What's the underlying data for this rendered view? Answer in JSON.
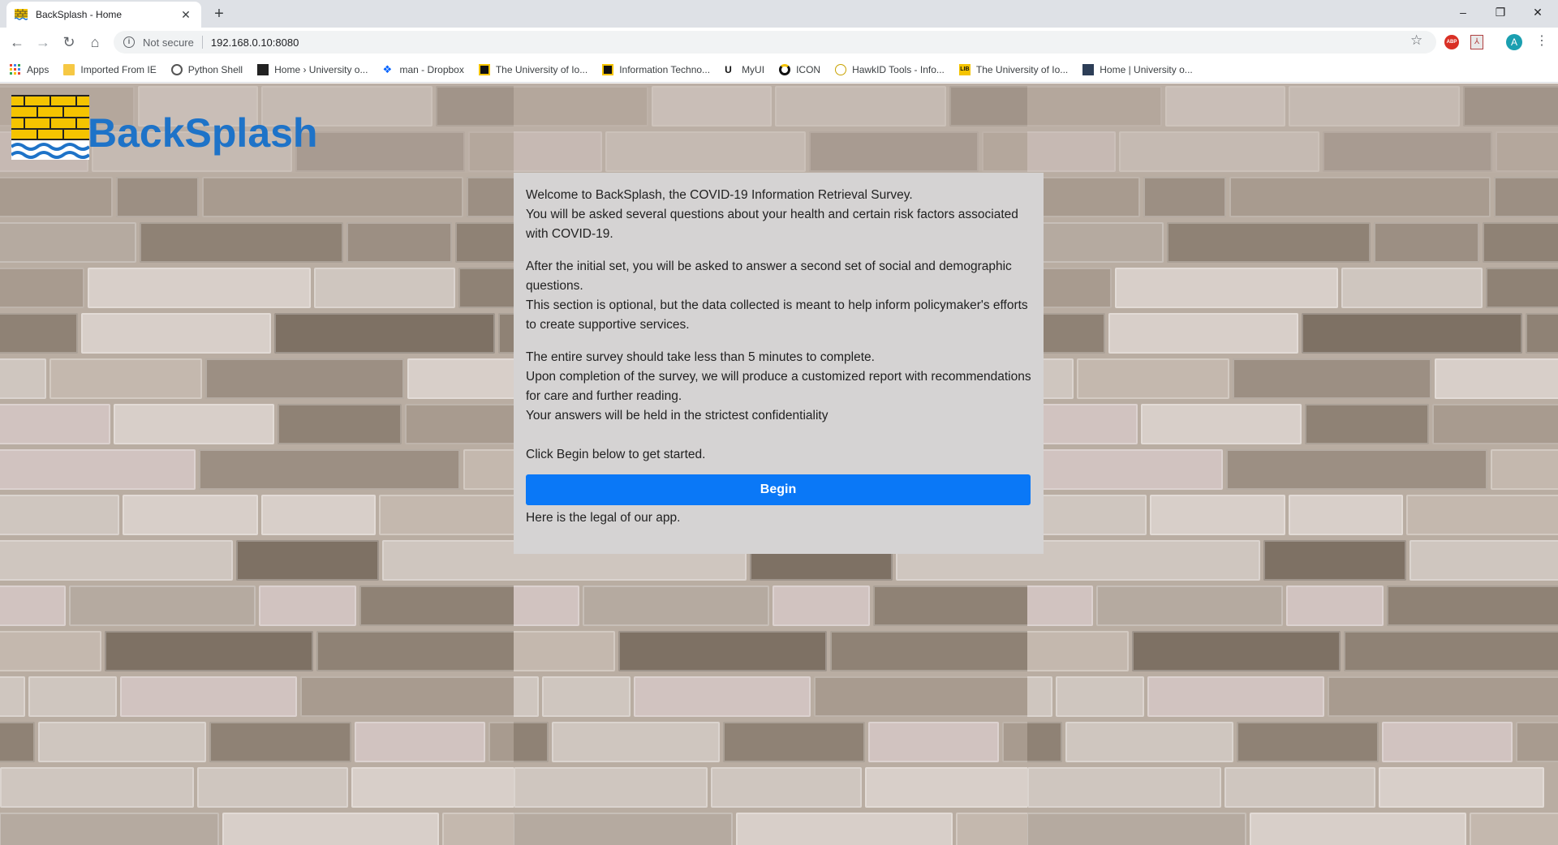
{
  "browser": {
    "tab_title": "BackSplash - Home",
    "tab_close": "✕",
    "new_tab": "+",
    "window_controls": {
      "minimize": "–",
      "restore": "❐",
      "close": "✕"
    },
    "security_label": "Not secure",
    "url": "192.168.0.10:8080",
    "avatar_letter": "A",
    "bookmarks": [
      {
        "label": "Apps",
        "icon": "apps-grid-icon"
      },
      {
        "label": "Imported From IE",
        "icon": "folder-icon"
      },
      {
        "label": "Python Shell",
        "icon": "globe-icon"
      },
      {
        "label": "Home › University o...",
        "icon": "university-icon"
      },
      {
        "label": "man - Dropbox",
        "icon": "dropbox-icon"
      },
      {
        "label": "The University of Io...",
        "icon": "university-icon"
      },
      {
        "label": "Information Techno...",
        "icon": "its-icon"
      },
      {
        "label": "MyUI",
        "icon": "myui-icon"
      },
      {
        "label": "ICON",
        "icon": "icon-logo-icon"
      },
      {
        "label": "HawkID Tools - Info...",
        "icon": "hawkid-icon"
      },
      {
        "label": "The University of Io...",
        "icon": "lib-icon"
      },
      {
        "label": "Home | University o...",
        "icon": "university-icon"
      }
    ]
  },
  "site": {
    "brand": "BackSplash",
    "colors": {
      "brand": "#1e73c8",
      "button": "#0a78f7",
      "panel": "#d5d3d3"
    }
  },
  "intro": {
    "line1": "Welcome to BackSplash, the COVID-19 Information Retrieval Survey.",
    "line2": "You will be asked several questions about your health and certain risk factors associated with COVID-19.",
    "line3": "After the initial set, you will be asked to answer a second set of social and demographic questions.",
    "line4": "This section is optional, but the data collected is meant to help inform policymaker's efforts to create supportive services.",
    "line5": "The entire survey should take less than 5 minutes to complete.",
    "line6": "Upon completion of the survey, we will produce a customized report with recommendations for care and further reading.",
    "line7": "Your answers will be held in the strictest confidentiality",
    "line8": "Click Begin below to get started.",
    "begin_label": "Begin",
    "legal": "Here is the legal of our app."
  }
}
